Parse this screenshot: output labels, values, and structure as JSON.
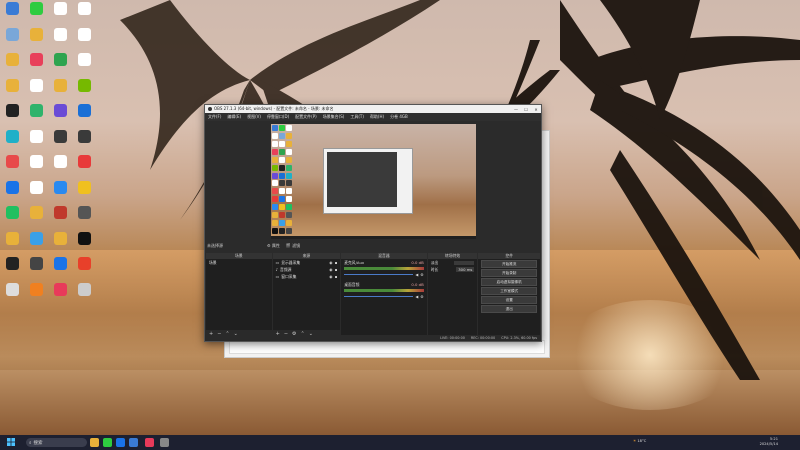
{
  "desktop": {
    "icons": [
      {
        "label": "",
        "color": "#3a7bd5"
      },
      {
        "label": "",
        "color": "#2ecc40"
      },
      {
        "label": "",
        "color": "#ffffff"
      },
      {
        "label": "",
        "color": "#ffffff"
      },
      {
        "label": "",
        "color": "#7aa7d8"
      },
      {
        "label": "",
        "color": "#e8b13a"
      },
      {
        "label": "",
        "color": "#ffffff"
      },
      {
        "label": "",
        "color": "#ffffff"
      },
      {
        "label": "",
        "color": "#e8b13a"
      },
      {
        "label": "",
        "color": "#e8405a"
      },
      {
        "label": "",
        "color": "#2ea44f"
      },
      {
        "label": "",
        "color": "#ffffff"
      },
      {
        "label": "",
        "color": "#e8b13a"
      },
      {
        "label": "",
        "color": "#ffffff"
      },
      {
        "label": "",
        "color": "#e8b13a"
      },
      {
        "label": "",
        "color": "#76b900"
      },
      {
        "label": "",
        "color": "#222222"
      },
      {
        "label": "",
        "color": "#2fb36b"
      },
      {
        "label": "",
        "color": "#6a4bd6"
      },
      {
        "label": "",
        "color": "#1a6fd6"
      },
      {
        "label": "",
        "color": "#20b0c8"
      },
      {
        "label": "",
        "color": "#ffffff"
      },
      {
        "label": "",
        "color": "#3a3a3a"
      },
      {
        "label": "",
        "color": "#3a3a3a"
      },
      {
        "label": "",
        "color": "#e84a4a"
      },
      {
        "label": "",
        "color": "#ffffff"
      },
      {
        "label": "",
        "color": "#ffffff"
      },
      {
        "label": "",
        "color": "#e83a3a"
      },
      {
        "label": "",
        "color": "#1a73e8"
      },
      {
        "label": "",
        "color": "#ffffff"
      },
      {
        "label": "",
        "color": "#2a8af0"
      },
      {
        "label": "",
        "color": "#f0c020"
      },
      {
        "label": "",
        "color": "#20c060"
      },
      {
        "label": "",
        "color": "#e8b13a"
      },
      {
        "label": "",
        "color": "#c0392b"
      },
      {
        "label": "",
        "color": "#555555"
      },
      {
        "label": "",
        "color": "#e8b13a"
      },
      {
        "label": "",
        "color": "#3aa0e8"
      },
      {
        "label": "",
        "color": "#e8b13a"
      },
      {
        "label": "",
        "color": "#111111"
      },
      {
        "label": "",
        "color": "#222222"
      },
      {
        "label": "",
        "color": "#444444"
      },
      {
        "label": "",
        "color": "#1a73e8"
      },
      {
        "label": "",
        "color": "#e8402a"
      },
      {
        "label": "",
        "color": "#dddddd"
      },
      {
        "label": "",
        "color": "#f08020"
      },
      {
        "label": "",
        "color": "#e83a5a"
      },
      {
        "label": "",
        "color": "#cccccc"
      }
    ]
  },
  "obs": {
    "title": "OBS 27.1.3 (64-bit, windows) - 配置文件: 未命名 - 场景: 未命名",
    "win_buttons": [
      "—",
      "☐",
      "✕"
    ],
    "menu": [
      "文件(F)",
      "编辑(E)",
      "视图(V)",
      "停靠窗口(D)",
      "配置文件(P)",
      "场景集合(S)",
      "工具(T)",
      "帮助(H)",
      "分卷 4GB"
    ],
    "scene_tabs": [
      "未选择源",
      "⚙ 属性",
      "🎬 滤镜"
    ],
    "docks": {
      "scenes": {
        "header": "场景",
        "items": [
          "场景"
        ]
      },
      "sources": {
        "header": "来源",
        "items": [
          "显示器采集",
          "音频源",
          "窗口采集"
        ]
      },
      "mixer": {
        "header": "混音器",
        "channels": [
          {
            "name": "麦克风/Aux",
            "db": "0.0 dB"
          },
          {
            "name": "桌面音频",
            "db": "0.0 dB"
          }
        ]
      },
      "transitions": {
        "header": "转场特效",
        "fields": [
          {
            "label": "淡出",
            "value": ""
          },
          {
            "label": "时长",
            "value": "300 ms"
          }
        ]
      },
      "controls": {
        "header": "控件",
        "buttons": [
          "开始推流",
          "开始录制",
          "启动虚拟摄像机",
          "工作室模式",
          "设置",
          "退出"
        ]
      }
    },
    "statusbar": [
      "LIVE: 00:00:00",
      "REC: 00:00:00",
      "CPU: 2.3%, 60.00 fps"
    ]
  },
  "taskbar": {
    "search_placeholder": "搜索",
    "weather": "18°C",
    "time": "5:21",
    "date": "2024/5/14",
    "icons": [
      {
        "color": "#e8b13a"
      },
      {
        "color": "#2ecc40"
      },
      {
        "color": "#1a73e8"
      },
      {
        "color": "#3a7bd5"
      },
      {
        "color": "#e83a5a"
      },
      {
        "color": "#888888"
      }
    ]
  }
}
